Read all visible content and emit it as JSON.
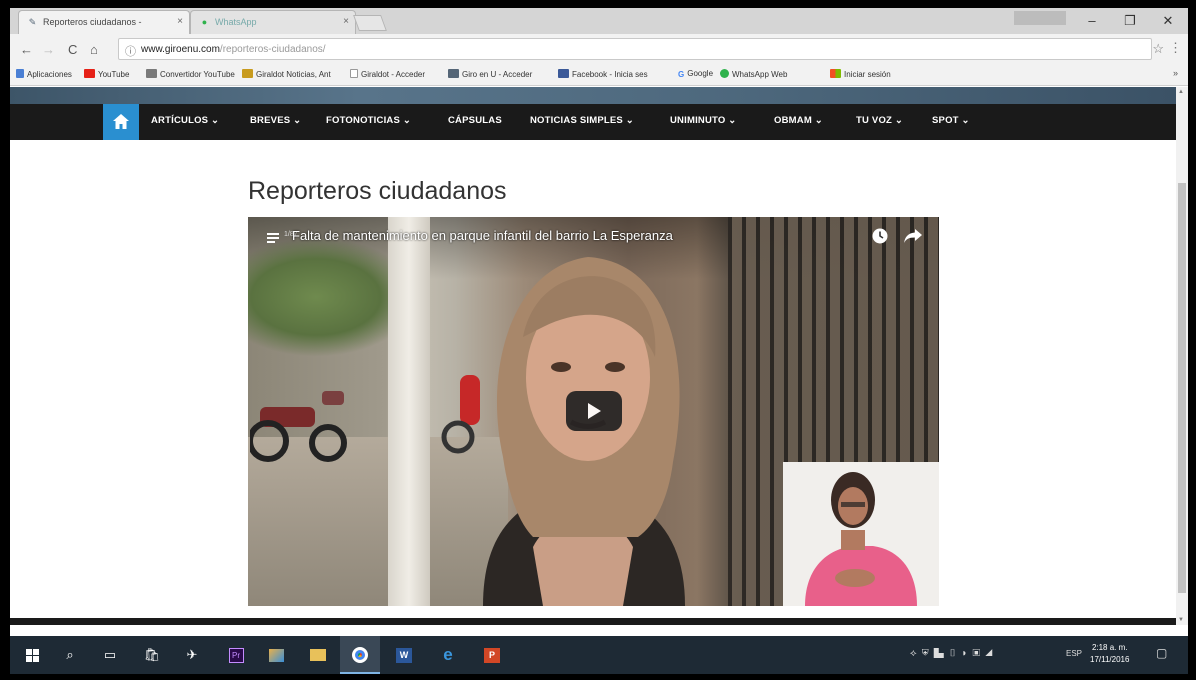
{
  "browser": {
    "tabs": [
      {
        "title": "Reporteros ciudadanos -",
        "icon": "giroenu-favicon"
      },
      {
        "title": "WhatsApp",
        "icon": "whatsapp-favicon"
      }
    ],
    "address": {
      "host": "www.giroenu.com",
      "path": "/reporteros-ciudadanos/"
    },
    "bookmarks": [
      {
        "label": "Aplicaciones",
        "icon": "apps-icon",
        "color": "#4a7fd4"
      },
      {
        "label": "YouTube",
        "icon": "youtube-icon",
        "color": "#e62117"
      },
      {
        "label": "Convertidor YouTube",
        "icon": "converter-icon",
        "color": "#7a7a7a"
      },
      {
        "label": "Giraldot Noticias, Ant",
        "icon": "news-icon",
        "color": "#c89b1e"
      },
      {
        "label": "Giraldot - Acceder",
        "icon": "page-icon",
        "color": "#9a9a9a"
      },
      {
        "label": "Giro en U - Acceder",
        "icon": "giroenu-icon",
        "color": "#556677"
      },
      {
        "label": "Facebook - Inicia ses",
        "icon": "facebook-icon",
        "color": "#3b5998"
      },
      {
        "label": "Google",
        "icon": "google-icon",
        "color": "#4285f4"
      },
      {
        "label": "WhatsApp Web",
        "icon": "whatsapp-icon",
        "color": "#2fb24c"
      },
      {
        "label": "Iniciar sesión",
        "icon": "microsoft-icon",
        "color": "#f3a61a"
      }
    ],
    "bookmarks_more": "»"
  },
  "site": {
    "nav": [
      "ARTÍCULOS ⌄",
      "BREVES ⌄",
      "FOTONOTICIAS ⌄",
      "CÁPSULAS",
      "NOTICIAS SIMPLES ⌄",
      "UNIMINUTO ⌄",
      "OBMAM ⌄",
      "TU VOZ ⌄",
      "SPOT ⌄"
    ],
    "accent_color": "#2a8fd0",
    "page_title": "Reporteros ciudadanos"
  },
  "video": {
    "counter": "1/87",
    "title": "Falta de mantenimiento en parque infantil del barrio La Esperanza"
  },
  "taskbar": {
    "apps": [
      "start-icon",
      "search-icon",
      "task-view-icon",
      "store-icon",
      "app-icon",
      "premiere-icon",
      "photos-icon",
      "folder-icon",
      "chrome-icon",
      "word-icon",
      "edge-icon",
      "powerpoint-icon"
    ],
    "lang": "ESP",
    "time": "2:18 a. m.",
    "date": "17/11/2016"
  }
}
